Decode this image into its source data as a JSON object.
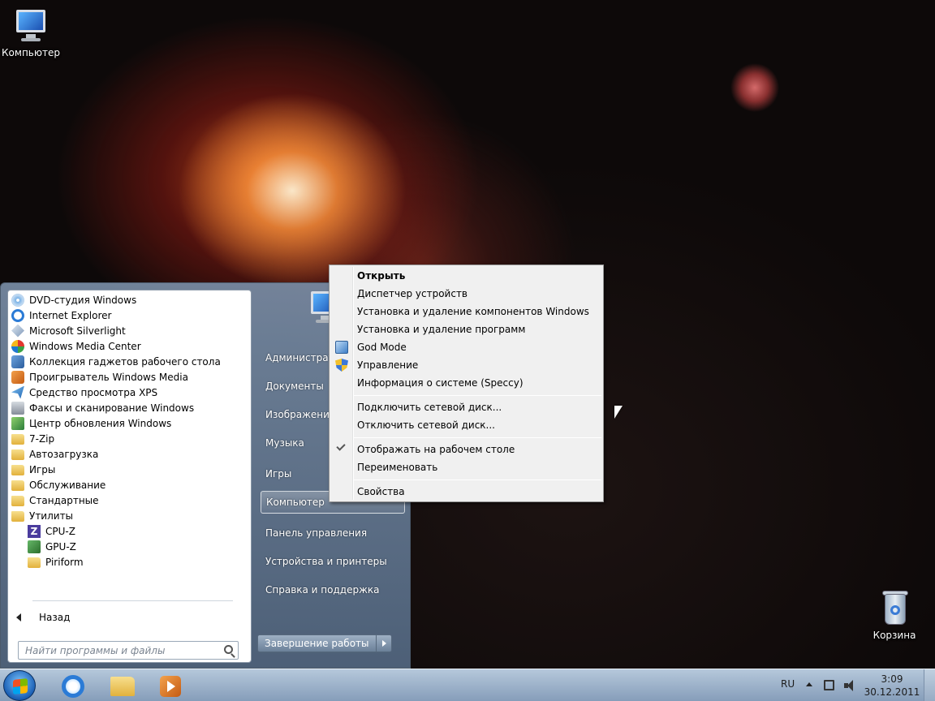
{
  "desktop": {
    "computer_label": "Компьютер",
    "recycle_bin_label": "Корзина"
  },
  "start_menu": {
    "programs": [
      {
        "label": "DVD-студия Windows",
        "icon": "dvd-icon"
      },
      {
        "label": "Internet Explorer",
        "icon": "ie-icon"
      },
      {
        "label": "Microsoft Silverlight",
        "icon": "silverlight-icon"
      },
      {
        "label": "Windows Media Center",
        "icon": "media-center-icon"
      },
      {
        "label": "Коллекция гаджетов рабочего стола",
        "icon": "gadgets-icon"
      },
      {
        "label": "Проигрыватель Windows Media",
        "icon": "media-player-icon"
      },
      {
        "label": "Средство просмотра XPS",
        "icon": "xps-icon"
      },
      {
        "label": "Факсы и сканирование Windows",
        "icon": "fax-icon"
      },
      {
        "label": "Центр обновления Windows",
        "icon": "update-icon"
      },
      {
        "label": "7-Zip",
        "icon": "folder-icon"
      },
      {
        "label": "Автозагрузка",
        "icon": "folder-icon"
      },
      {
        "label": "Игры",
        "icon": "folder-icon"
      },
      {
        "label": "Обслуживание",
        "icon": "folder-icon"
      },
      {
        "label": "Стандартные",
        "icon": "folder-icon"
      },
      {
        "label": "Утилиты",
        "icon": "folder-icon"
      },
      {
        "label": "CPU-Z",
        "icon": "cpuz-icon"
      },
      {
        "label": "GPU-Z",
        "icon": "gpuz-icon"
      },
      {
        "label": "Piriform",
        "icon": "folder-icon"
      }
    ],
    "back_label": "Назад",
    "search_placeholder": "Найти программы и файлы",
    "right_items": [
      {
        "label": "Администратор"
      },
      {
        "label": "Документы"
      },
      {
        "label": "Изображения"
      },
      {
        "label": "Музыка"
      },
      {
        "label": "Игры"
      },
      {
        "label": "Компьютер"
      },
      {
        "label": "Панель управления"
      },
      {
        "label": "Устройства и принтеры"
      },
      {
        "label": "Справка и поддержка"
      }
    ],
    "shutdown_label": "Завершение работы"
  },
  "context_menu": {
    "open": "Открыть",
    "device_manager": "Диспетчер устройств",
    "windows_components": "Установка и удаление компонентов Windows",
    "programs": "Установка и удаление программ",
    "god_mode": "God Mode",
    "manage": "Управление",
    "system_info": "Информация о системе (Speccy)",
    "map_drive": "Подключить сетевой диск...",
    "disconnect_drive": "Отключить сетевой диск...",
    "show_on_desktop": "Отображать на рабочем столе",
    "rename": "Переименовать",
    "properties": "Свойства"
  },
  "taskbar": {
    "language": "RU",
    "time": "3:09",
    "date": "30.12.2011"
  }
}
